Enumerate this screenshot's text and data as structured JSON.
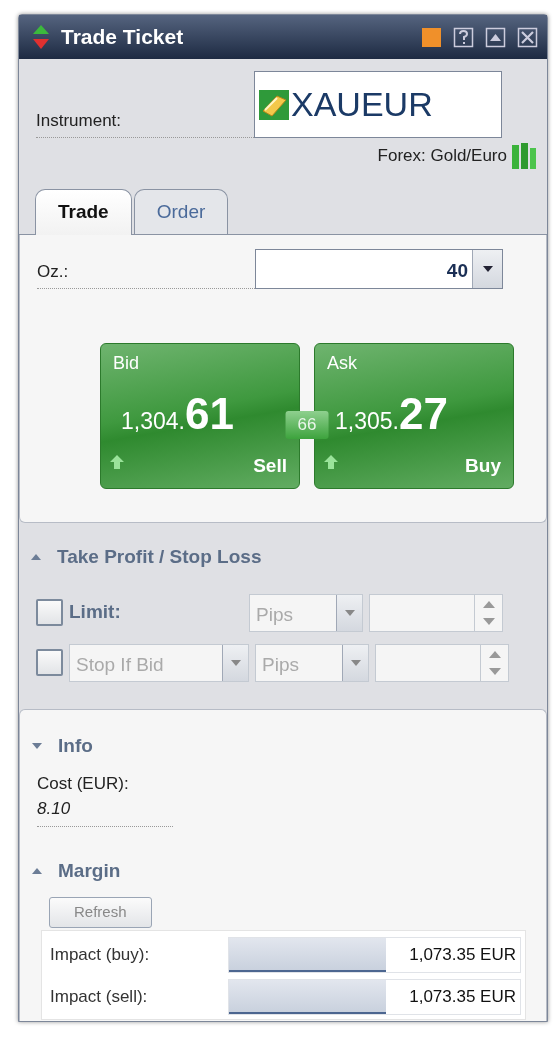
{
  "window": {
    "title": "Trade Ticket"
  },
  "instrument": {
    "label": "Instrument:",
    "symbol": "XAUEUR",
    "description": "Forex: Gold/Euro"
  },
  "tabs": [
    {
      "label": "Trade",
      "selected": true
    },
    {
      "label": "Order",
      "selected": false
    }
  ],
  "amount": {
    "label": "Oz.:",
    "value": "40"
  },
  "quotes": [
    {
      "label": "Bid",
      "price_major": "1,304.",
      "price_pips": "61",
      "action": "Sell"
    },
    {
      "label": "Ask",
      "price_major": "1,305.",
      "price_pips": "27",
      "action": "Buy"
    }
  ],
  "spread": "66",
  "take_profit_stop_loss": {
    "title": "Take Profit / Stop Loss",
    "expanded": true,
    "rows": [
      {
        "kind": "label",
        "checked": false,
        "disabled": true,
        "label": "Limit:",
        "unit": "Pips"
      },
      {
        "kind": "select",
        "checked": false,
        "disabled": true,
        "type": "Stop If Bid",
        "unit": "Pips"
      }
    ]
  },
  "info": {
    "title": "Info",
    "expanded": false,
    "cost_label": "Cost (EUR):",
    "cost_value": "8.10"
  },
  "margin": {
    "title": "Margin",
    "expanded": true,
    "refresh_button": "Refresh",
    "rows": [
      {
        "label": "Impact (buy):",
        "level": 0.54,
        "value": "1,073.35 EUR"
      },
      {
        "label": "Impact (sell):",
        "level": 0.54,
        "value": "1,073.35 EUR"
      }
    ]
  }
}
